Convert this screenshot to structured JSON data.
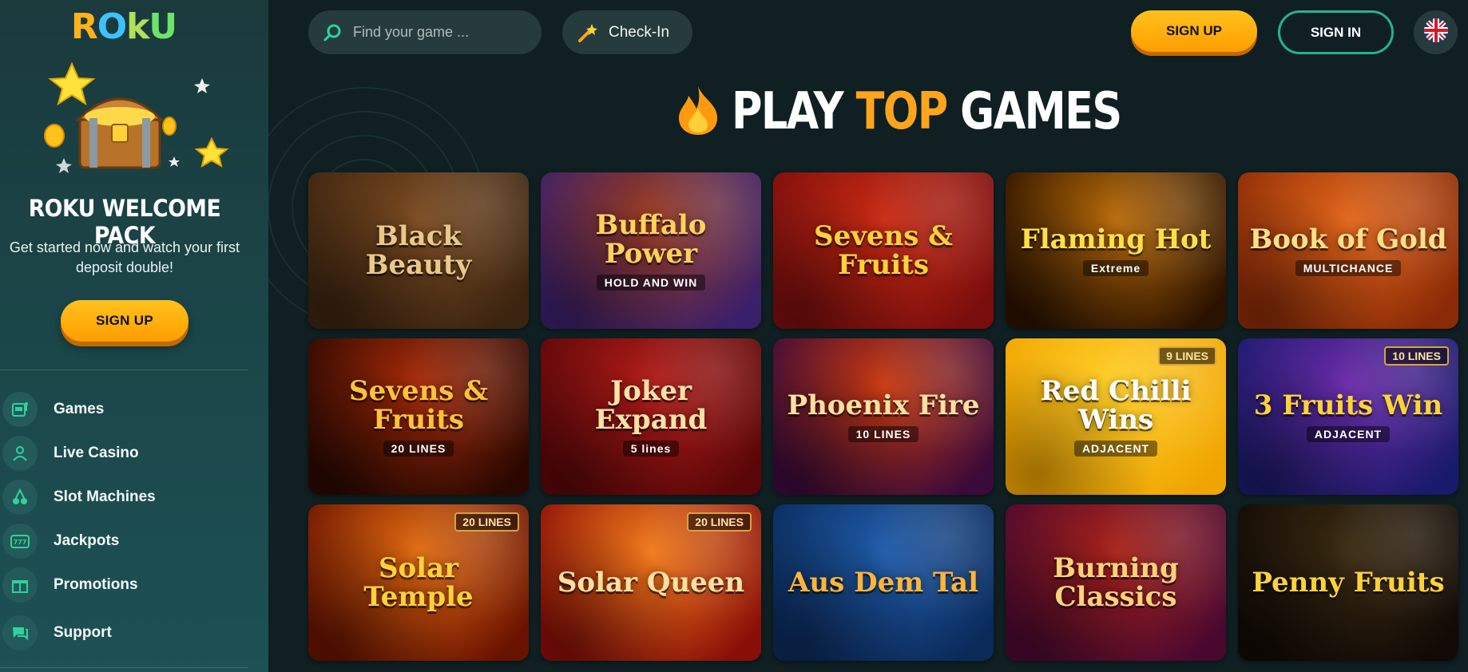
{
  "sidebar": {
    "logo_letters": [
      "R",
      "O",
      "k",
      "U"
    ],
    "welcome_title": "ROKU WELCOME PACK",
    "welcome_text": "Get started now and watch your first deposit double!",
    "signup_label": "SIGN UP",
    "nav": [
      {
        "label": "Games",
        "icon": "slot-machine-icon"
      },
      {
        "label": "Live Casino",
        "icon": "dealer-icon"
      },
      {
        "label": "Slot Machines",
        "icon": "cherries-icon"
      },
      {
        "label": "Jackpots",
        "icon": "jackpot-777-icon"
      },
      {
        "label": "Promotions",
        "icon": "gift-icon"
      },
      {
        "label": "Support",
        "icon": "chat-icon"
      }
    ]
  },
  "header": {
    "search_placeholder": "Find your game ...",
    "checkin_label": "Check-In",
    "signup_label": "SIGN UP",
    "signin_label": "SIGN IN",
    "language_icon": "uk-flag-icon"
  },
  "section": {
    "title_part1": "PLAY ",
    "title_highlight": "TOP",
    "title_part2": " GAMES",
    "accent_color": "#ffa51c"
  },
  "games": [
    {
      "title": "Black Beauty",
      "badge": "",
      "bg": [
        "#3b2410",
        "#7a4a20"
      ],
      "color": "#e9c98a"
    },
    {
      "title": "Buffalo Power",
      "subtitle": "HOLD AND WIN",
      "badge": "",
      "bg": [
        "#3a1f6b",
        "#9a3a1c"
      ],
      "color": "#ffd25a"
    },
    {
      "title": "Sevens & Fruits",
      "badge": "",
      "bg": [
        "#7a0d0d",
        "#c72a12"
      ],
      "color": "#ffd23a"
    },
    {
      "title": "Flaming Hot",
      "subtitle": "Extreme",
      "badge": "",
      "bg": [
        "#2a1200",
        "#b86a08"
      ],
      "color": "#ffe04a"
    },
    {
      "title": "Book of Gold",
      "subtitle": "MULTICHANCE",
      "badge": "",
      "bg": [
        "#8a2a06",
        "#e0651a"
      ],
      "color": "#ffe08a"
    },
    {
      "title": "Sevens & Fruits",
      "subtitle": "20 LINES",
      "badge": "",
      "bg": [
        "#2a0800",
        "#a82a08"
      ],
      "color": "#ffc23a"
    },
    {
      "title": "Joker Expand",
      "subtitle": "5 lines",
      "badge": "",
      "bg": [
        "#5a0608",
        "#b21c18"
      ],
      "color": "#ffe2a6"
    },
    {
      "title": "Phoenix Fire",
      "subtitle": "10 LINES",
      "badge": "",
      "bg": [
        "#3a0a3a",
        "#c8380e"
      ],
      "color": "#ffe0a0"
    },
    {
      "title": "Red Chilli Wins",
      "subtitle": "ADJACENT",
      "badge": "9 LINES",
      "bg": [
        "#f0a400",
        "#ffcf2a"
      ],
      "color": "#ffffff"
    },
    {
      "title": "3 Fruits Win",
      "subtitle": "ADJACENT",
      "badge": "10 LINES",
      "bg": [
        "#1a1a6a",
        "#6a2aa8"
      ],
      "color": "#ffd23a"
    },
    {
      "title": "Solar Temple",
      "badge": "20 LINES",
      "bg": [
        "#6a1200",
        "#e06a10"
      ],
      "color": "#ffd23a"
    },
    {
      "title": "Solar Queen",
      "badge": "20 LINES",
      "bg": [
        "#8a0e08",
        "#f07a1a"
      ],
      "color": "#ffe0a0"
    },
    {
      "title": "Aus Dem Tal",
      "badge": "",
      "bg": [
        "#0a2a5a",
        "#1e5aa8"
      ],
      "color": "#ffb43a"
    },
    {
      "title": "Burning Classics",
      "badge": "",
      "bg": [
        "#4a0830",
        "#a82218"
      ],
      "color": "#ffd27a"
    },
    {
      "title": "Penny Fruits",
      "badge": "",
      "bg": [
        "#120a06",
        "#3a2a10"
      ],
      "color": "#ffd23a"
    }
  ]
}
